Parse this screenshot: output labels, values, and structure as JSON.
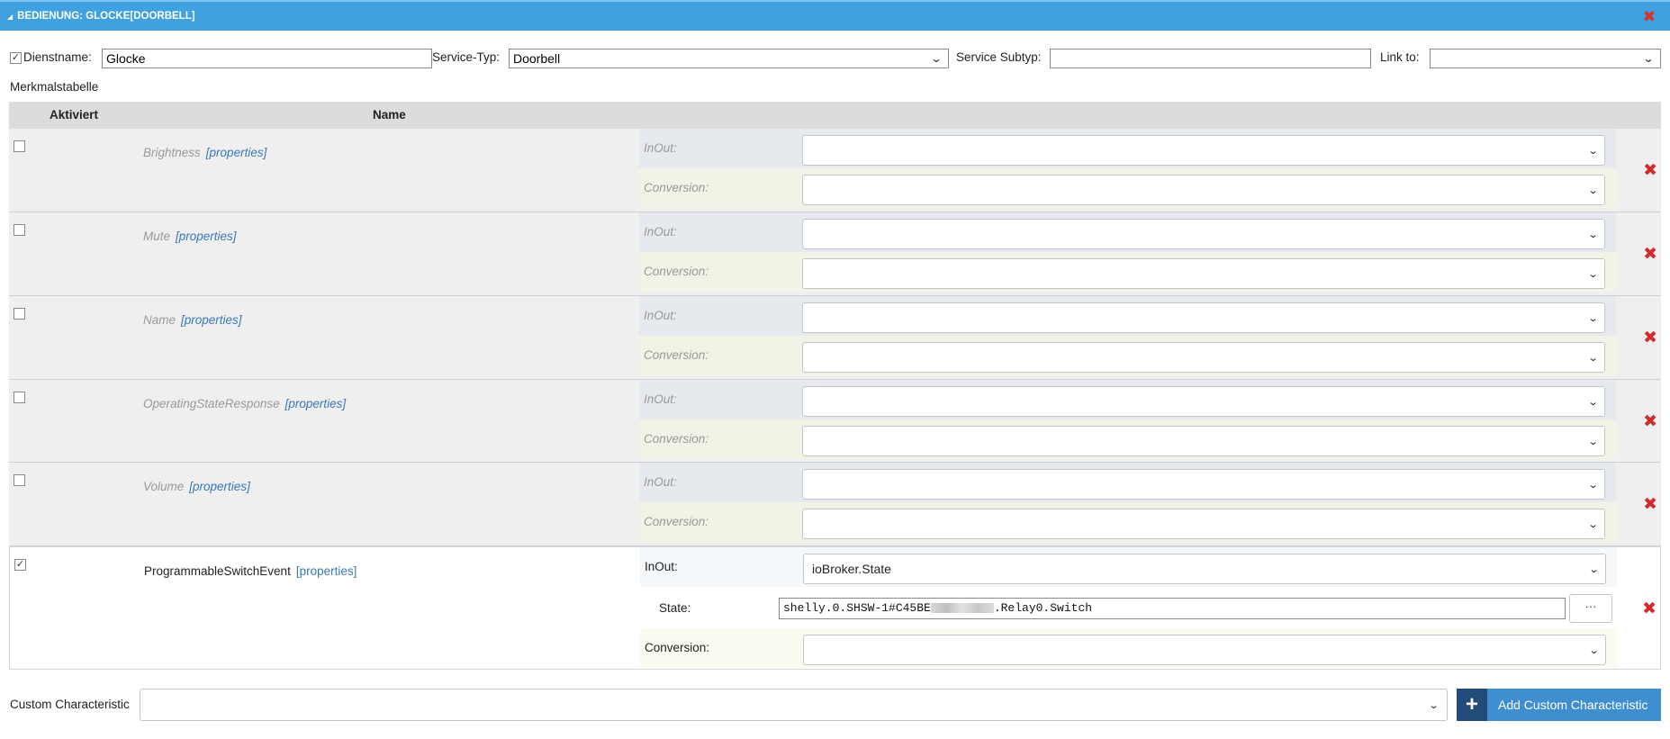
{
  "titlebar": {
    "title": "BEDIENUNG: GLOCKE[DOORBELL]",
    "close": "✖"
  },
  "form": {
    "service_name_label": "Dienstname:",
    "service_name_value": "Glocke",
    "service_name_checked": "✓",
    "service_type_label": "Service-Typ:",
    "service_type_value": "Doorbell",
    "service_subtype_label": "Service Subtyp:",
    "service_subtype_value": "",
    "link_to_label": "Link to:",
    "link_to_value": ""
  },
  "table": {
    "caption": "Merkmalstabelle",
    "col_activated": "Aktiviert",
    "col_name": "Name",
    "properties_link": "[properties]",
    "inout_label": "InOut:",
    "conversion_label": "Conversion:",
    "state_label": "State:",
    "rows": [
      {
        "name": "Brightness",
        "checked": "",
        "inout": "",
        "conversion": ""
      },
      {
        "name": "Mute",
        "checked": "",
        "inout": "",
        "conversion": ""
      },
      {
        "name": "Name",
        "checked": "",
        "inout": "",
        "conversion": ""
      },
      {
        "name": "OperatingStateResponse",
        "checked": "",
        "inout": "",
        "conversion": ""
      },
      {
        "name": "Volume",
        "checked": "",
        "inout": "",
        "conversion": ""
      },
      {
        "name": "ProgrammableSwitchEvent",
        "checked": "✓",
        "inout": "ioBroker.State",
        "state_prefix": "shelly.0.SHSW-1#C45BE",
        "state_suffix": ".Relay0.Switch",
        "state_button": "···",
        "conversion": ""
      }
    ],
    "delete_icon": "✖"
  },
  "custom": {
    "label": "Custom Characteristic",
    "value": "",
    "add_plus": "+",
    "add_label": "Add Custom Characteristic"
  },
  "colors": {
    "titlebar": "#3fa1e0",
    "accent": "#3e8ed0",
    "delete": "#d12c2c"
  }
}
